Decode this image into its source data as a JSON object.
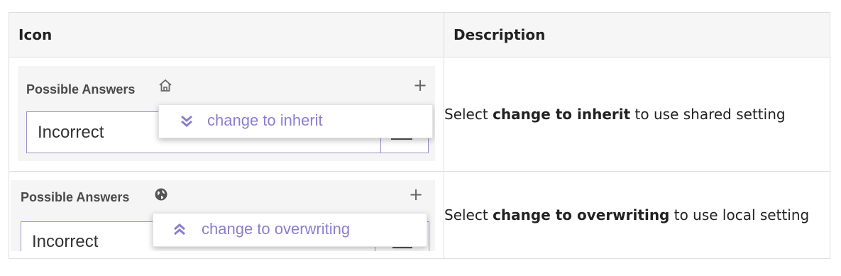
{
  "table": {
    "headers": {
      "icon": "Icon",
      "description": "Description"
    },
    "rows": [
      {
        "screenshot": {
          "section_label": "Possible Answers",
          "section_icon": "home-icon",
          "add_symbol": "+",
          "input_value": "Incorrect",
          "popup_icon": "double-chevron-down-icon",
          "popup_label": "change to inherit"
        },
        "description": {
          "prefix": "Select ",
          "bold": "change to inherit",
          "suffix": " to use shared setting"
        }
      },
      {
        "screenshot": {
          "section_label": "Possible Answers",
          "section_icon": "globe-icon",
          "add_symbol": "+",
          "input_value": "Incorrect",
          "popup_icon": "double-chevron-up-icon",
          "popup_label": "change to overwriting"
        },
        "description": {
          "prefix": "Select ",
          "bold": "change to overwriting",
          "suffix": " to use local setting"
        }
      }
    ]
  },
  "colors": {
    "accent": "#8a7fcf",
    "input_border": "#9b8fd0",
    "header_bg": "#f6f6f6",
    "border": "#dedede"
  }
}
